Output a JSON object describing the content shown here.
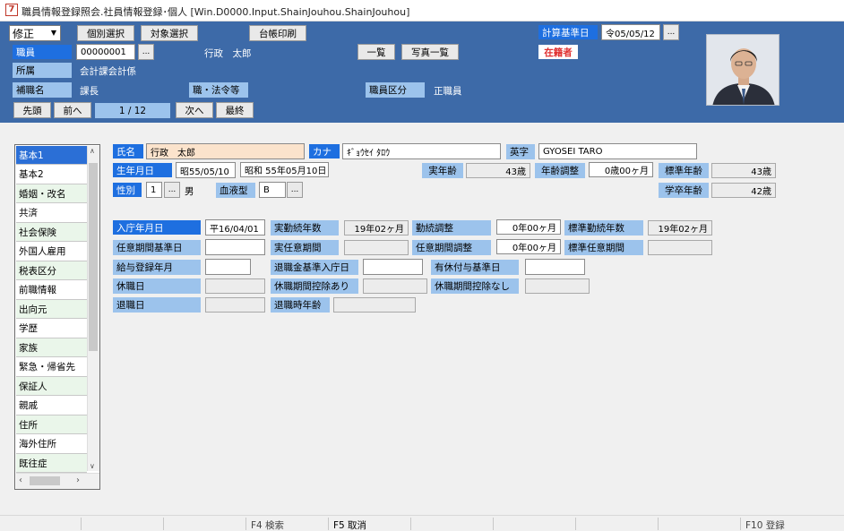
{
  "window": {
    "icon_text": "7",
    "title": "職員情報登録照会.社員情報登録･個人 [Win.D0000.Input.ShainJouhou.ShainJouhou]"
  },
  "header": {
    "mode": "修正",
    "btn_individual": "個別選択",
    "btn_target": "対象選択",
    "btn_ledger": "台帳印刷",
    "calc_date_label": "計算基準日",
    "calc_date_value": "令05/05/12",
    "ellipsis": "...",
    "employee_label": "職員",
    "employee_no": "00000001",
    "employee_name": "行政　太郎",
    "btn_list": "一覧",
    "btn_photo_list": "写真一覧",
    "status_badge": "在籍者",
    "dept_label": "所属",
    "dept_value": "会計課会計係",
    "position_label": "補職名",
    "position_value": "課長",
    "title_label": "職・法令等",
    "category_label": "職員区分",
    "category_value": "正職員",
    "btn_first": "先頭",
    "btn_prev": "前へ",
    "page_indicator": "1 / 12",
    "btn_next": "次へ",
    "btn_last": "最終"
  },
  "sidebar": {
    "items": [
      "基本1",
      "基本2",
      "婚姻・改名",
      "共済",
      "社会保険",
      "外国人雇用",
      "税表区分",
      "前職情報",
      "出向元",
      "学歴",
      "家族",
      "緊急・帰省先",
      "保証人",
      "親戚",
      "住所",
      "海外住所",
      "既往症"
    ],
    "selected_index": 0
  },
  "basic": {
    "name_label": "氏名",
    "name_value": "行政　太郎",
    "kana_label": "カナ",
    "kana_value": "ｷﾞｮｳｾｲ ﾀﾛｳ",
    "eiji_label": "英字",
    "eiji_value": "GYOSEI TARO",
    "birth_label": "生年月日",
    "birth_short": "昭55/05/10",
    "birth_long": "昭和 55年05月10日",
    "age_label": "実年齢",
    "age_value": "43歳",
    "age_adj_label": "年齢調整",
    "age_adj_value": "0歳00ヶ月",
    "std_age_label": "標準年齢",
    "std_age_value": "43歳",
    "gender_label": "性別",
    "gender_code": "1",
    "gender_text": "男",
    "blood_label": "血液型",
    "blood_value": "B",
    "grad_age_label": "学卒年齢",
    "grad_age_value": "42歳"
  },
  "service": {
    "join_date_label": "入庁年月日",
    "join_date_value": "平16/04/01",
    "actual_years_label": "実勤続年数",
    "actual_years_value": "19年02ヶ月",
    "service_adj_label": "勤続調整",
    "service_adj_value": "0年00ヶ月",
    "std_years_label": "標準勤続年数",
    "std_years_value": "19年02ヶ月",
    "opt_base_label": "任意期間基準日",
    "opt_actual_label": "実任意期間",
    "opt_adj_label": "任意期間調整",
    "opt_adj_value": "0年00ヶ月",
    "std_opt_label": "標準任意期間",
    "salary_reg_label": "給与登録年月",
    "retire_base_label": "退職金基準入庁日",
    "paid_leave_label": "有休付与基準日",
    "leave_date_label": "休職日",
    "leave_deduct_yes_label": "休職期間控除あり",
    "leave_deduct_no_label": "休職期間控除なし",
    "retire_date_label": "退職日",
    "retire_age_label": "退職時年齢"
  },
  "fkeys": {
    "f4": "F4 検索",
    "f5": "F5 取消",
    "f10": "F10 登録"
  }
}
